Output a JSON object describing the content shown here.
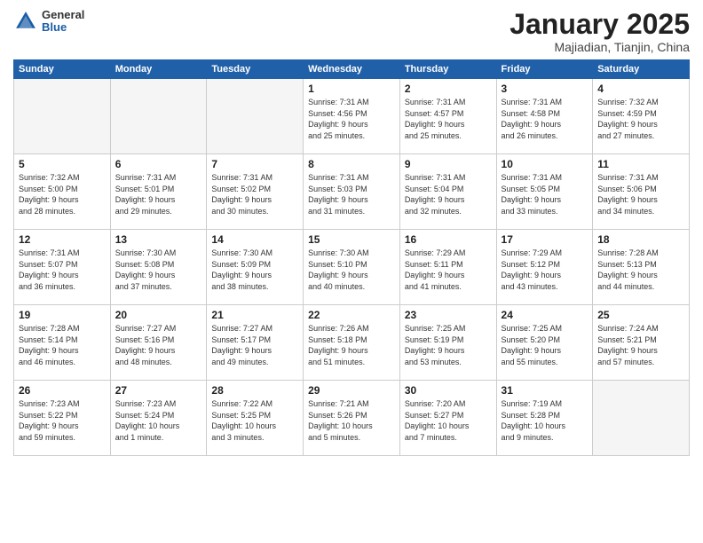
{
  "header": {
    "logo_general": "General",
    "logo_blue": "Blue",
    "title": "January 2025",
    "subtitle": "Majiadian, Tianjin, China"
  },
  "weekdays": [
    "Sunday",
    "Monday",
    "Tuesday",
    "Wednesday",
    "Thursday",
    "Friday",
    "Saturday"
  ],
  "weeks": [
    [
      {
        "day": "",
        "info": ""
      },
      {
        "day": "",
        "info": ""
      },
      {
        "day": "",
        "info": ""
      },
      {
        "day": "1",
        "info": "Sunrise: 7:31 AM\nSunset: 4:56 PM\nDaylight: 9 hours\nand 25 minutes."
      },
      {
        "day": "2",
        "info": "Sunrise: 7:31 AM\nSunset: 4:57 PM\nDaylight: 9 hours\nand 25 minutes."
      },
      {
        "day": "3",
        "info": "Sunrise: 7:31 AM\nSunset: 4:58 PM\nDaylight: 9 hours\nand 26 minutes."
      },
      {
        "day": "4",
        "info": "Sunrise: 7:32 AM\nSunset: 4:59 PM\nDaylight: 9 hours\nand 27 minutes."
      }
    ],
    [
      {
        "day": "5",
        "info": "Sunrise: 7:32 AM\nSunset: 5:00 PM\nDaylight: 9 hours\nand 28 minutes."
      },
      {
        "day": "6",
        "info": "Sunrise: 7:31 AM\nSunset: 5:01 PM\nDaylight: 9 hours\nand 29 minutes."
      },
      {
        "day": "7",
        "info": "Sunrise: 7:31 AM\nSunset: 5:02 PM\nDaylight: 9 hours\nand 30 minutes."
      },
      {
        "day": "8",
        "info": "Sunrise: 7:31 AM\nSunset: 5:03 PM\nDaylight: 9 hours\nand 31 minutes."
      },
      {
        "day": "9",
        "info": "Sunrise: 7:31 AM\nSunset: 5:04 PM\nDaylight: 9 hours\nand 32 minutes."
      },
      {
        "day": "10",
        "info": "Sunrise: 7:31 AM\nSunset: 5:05 PM\nDaylight: 9 hours\nand 33 minutes."
      },
      {
        "day": "11",
        "info": "Sunrise: 7:31 AM\nSunset: 5:06 PM\nDaylight: 9 hours\nand 34 minutes."
      }
    ],
    [
      {
        "day": "12",
        "info": "Sunrise: 7:31 AM\nSunset: 5:07 PM\nDaylight: 9 hours\nand 36 minutes."
      },
      {
        "day": "13",
        "info": "Sunrise: 7:30 AM\nSunset: 5:08 PM\nDaylight: 9 hours\nand 37 minutes."
      },
      {
        "day": "14",
        "info": "Sunrise: 7:30 AM\nSunset: 5:09 PM\nDaylight: 9 hours\nand 38 minutes."
      },
      {
        "day": "15",
        "info": "Sunrise: 7:30 AM\nSunset: 5:10 PM\nDaylight: 9 hours\nand 40 minutes."
      },
      {
        "day": "16",
        "info": "Sunrise: 7:29 AM\nSunset: 5:11 PM\nDaylight: 9 hours\nand 41 minutes."
      },
      {
        "day": "17",
        "info": "Sunrise: 7:29 AM\nSunset: 5:12 PM\nDaylight: 9 hours\nand 43 minutes."
      },
      {
        "day": "18",
        "info": "Sunrise: 7:28 AM\nSunset: 5:13 PM\nDaylight: 9 hours\nand 44 minutes."
      }
    ],
    [
      {
        "day": "19",
        "info": "Sunrise: 7:28 AM\nSunset: 5:14 PM\nDaylight: 9 hours\nand 46 minutes."
      },
      {
        "day": "20",
        "info": "Sunrise: 7:27 AM\nSunset: 5:16 PM\nDaylight: 9 hours\nand 48 minutes."
      },
      {
        "day": "21",
        "info": "Sunrise: 7:27 AM\nSunset: 5:17 PM\nDaylight: 9 hours\nand 49 minutes."
      },
      {
        "day": "22",
        "info": "Sunrise: 7:26 AM\nSunset: 5:18 PM\nDaylight: 9 hours\nand 51 minutes."
      },
      {
        "day": "23",
        "info": "Sunrise: 7:25 AM\nSunset: 5:19 PM\nDaylight: 9 hours\nand 53 minutes."
      },
      {
        "day": "24",
        "info": "Sunrise: 7:25 AM\nSunset: 5:20 PM\nDaylight: 9 hours\nand 55 minutes."
      },
      {
        "day": "25",
        "info": "Sunrise: 7:24 AM\nSunset: 5:21 PM\nDaylight: 9 hours\nand 57 minutes."
      }
    ],
    [
      {
        "day": "26",
        "info": "Sunrise: 7:23 AM\nSunset: 5:22 PM\nDaylight: 9 hours\nand 59 minutes."
      },
      {
        "day": "27",
        "info": "Sunrise: 7:23 AM\nSunset: 5:24 PM\nDaylight: 10 hours\nand 1 minute."
      },
      {
        "day": "28",
        "info": "Sunrise: 7:22 AM\nSunset: 5:25 PM\nDaylight: 10 hours\nand 3 minutes."
      },
      {
        "day": "29",
        "info": "Sunrise: 7:21 AM\nSunset: 5:26 PM\nDaylight: 10 hours\nand 5 minutes."
      },
      {
        "day": "30",
        "info": "Sunrise: 7:20 AM\nSunset: 5:27 PM\nDaylight: 10 hours\nand 7 minutes."
      },
      {
        "day": "31",
        "info": "Sunrise: 7:19 AM\nSunset: 5:28 PM\nDaylight: 10 hours\nand 9 minutes."
      },
      {
        "day": "",
        "info": ""
      }
    ]
  ]
}
